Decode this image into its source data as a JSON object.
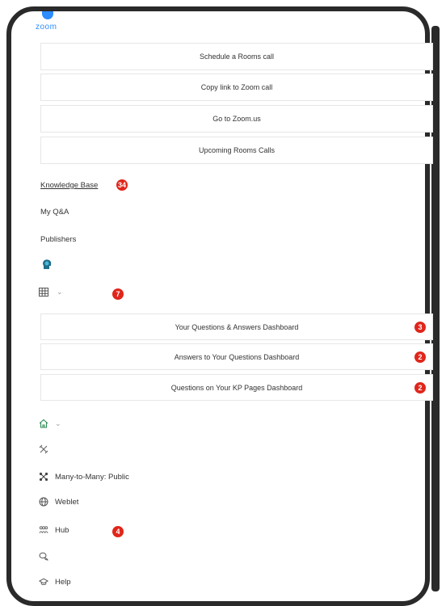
{
  "brand": {
    "logo_text": "zoom",
    "color": "#2d8cff"
  },
  "zoom_actions": [
    {
      "label": "Schedule a Rooms call"
    },
    {
      "label": "Copy link to Zoom call"
    },
    {
      "label": "Go to Zoom.us"
    },
    {
      "label": "Upcoming Rooms Calls"
    }
  ],
  "nav": {
    "knowledge_base": {
      "label": "Knowledge Base",
      "badge": "34"
    },
    "my_qa": {
      "label": "My Q&A"
    },
    "publishers": {
      "label": "Publishers"
    },
    "table_menu": {
      "badge": "7",
      "icon": "table-icon"
    }
  },
  "dashboards": [
    {
      "label": "Your Questions & Answers Dashboard",
      "badge": "3"
    },
    {
      "label": "Answers to Your Questions Dashboard",
      "badge": "2"
    },
    {
      "label": "Questions on Your KP Pages Dashboard",
      "badge": "2"
    }
  ],
  "bottom_nav": {
    "home": {
      "icon": "home-icon"
    },
    "tools": {
      "icon": "tools-icon"
    },
    "many_to_many": {
      "label": "Many-to-Many: Public",
      "icon": "network-icon"
    },
    "weblet": {
      "label": "Weblet",
      "icon": "globe-icon"
    },
    "hub": {
      "label": "Hub",
      "badge": "4",
      "icon": "hub-icon"
    },
    "chat": {
      "icon": "chat-icon"
    },
    "help": {
      "label": "Help",
      "icon": "help-icon"
    }
  },
  "colors": {
    "badge": "#e0261b",
    "border": "#e6e6e6",
    "home_icon": "#2e8b57"
  }
}
